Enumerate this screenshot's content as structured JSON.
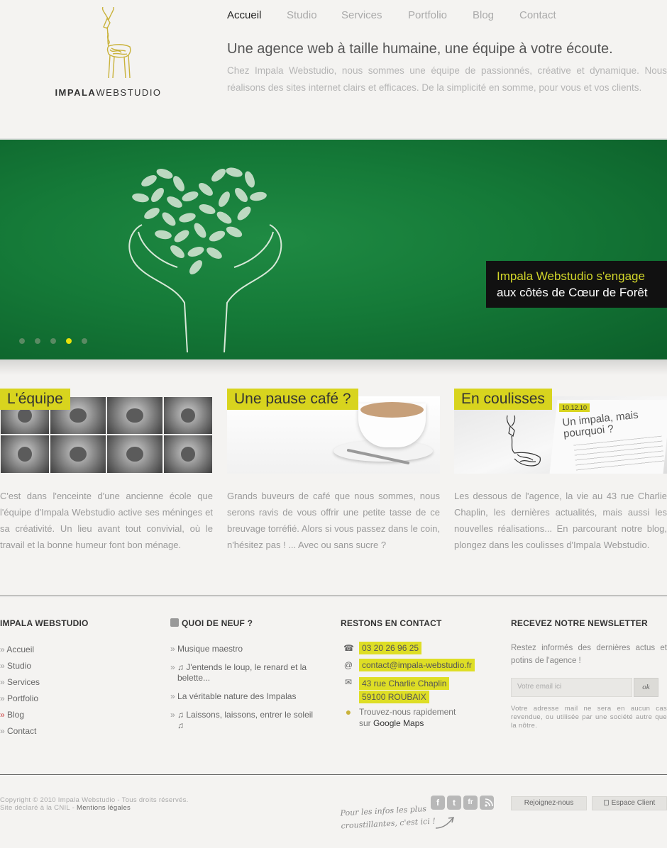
{
  "logo": {
    "name_bold": "IMPALA",
    "name_light": "WEBSTUDIO"
  },
  "nav": [
    {
      "label": "Accueil",
      "active": true
    },
    {
      "label": "Studio"
    },
    {
      "label": "Services"
    },
    {
      "label": "Portfolio"
    },
    {
      "label": "Blog"
    },
    {
      "label": "Contact"
    }
  ],
  "header": {
    "tagline": "Une agence web à taille humaine, une équipe à votre écoute.",
    "intro": "Chez Impala Webstudio, nous sommes une équipe de passionnés, créative et dynamique. Nous réalisons des sites internet clairs et efficaces. De la simplicité en somme, pour vous et vos clients."
  },
  "slider": {
    "caption_line1": "Impala Webstudio s'engage",
    "caption_line2": "aux côtés de Cœur de Forêt",
    "dots": 5,
    "active_dot": 4,
    "accent": "#d2d62a"
  },
  "features": [
    {
      "label": "L'équipe",
      "text": "C'est dans l'enceinte d'une ancienne école que l'équipe d'Impala Webstudio active ses méninges et sa créativité. Un lieu avant tout convivial, où le travail et la bonne humeur font bon ménage."
    },
    {
      "label": "Une pause café ?",
      "text": "Grands buveurs de café que nous sommes, nous serons ravis de vous offrir une petite tasse de ce breuvage torréfié. Alors si vous passez dans le coin, n'hésitez pas ! ... Avec ou sans sucre ?"
    },
    {
      "label": "En coulisses",
      "text": "Les dessous de l'agence, la vie au 43 rue Charlie Chaplin, les dernières actualités, mais aussi les nouvelles réalisations... En parcourant notre blog, plongez dans les coulisses d'Impala Webstudio.",
      "img_date": "10.12.10",
      "img_title": "Un impala, mais pourquoi ?"
    }
  ],
  "footer": {
    "col1": {
      "title": "IMPALA WEBSTUDIO",
      "links": [
        "Accueil",
        "Studio",
        "Services",
        "Portfolio",
        "Blog",
        "Contact"
      ]
    },
    "col2": {
      "title": "QUOI DE NEUF ?",
      "items": [
        "Musique maestro",
        "♫ J'entends le loup, le renard et la belette...",
        "La véritable nature des Impalas",
        "♫ Laissons, laissons, entrer le soleil ♫"
      ]
    },
    "col3": {
      "title": "RESTONS EN CONTACT",
      "phone": "03 20 26 96 25",
      "email": "contact@impala-webstudio.fr",
      "address1": "43 rue Charlie Chaplin",
      "address2": "59100 ROUBAIX",
      "maps_line1": "Trouvez-nous rapidement",
      "maps_line2_prefix": "sur ",
      "maps_link": "Google Maps"
    },
    "col4": {
      "title": "RECEVEZ NOTRE NEWSLETTER",
      "text": "Restez informés des dernières actus et potins de l'agence !",
      "placeholder": "Votre email ici",
      "button": "ok",
      "note": "Votre adresse mail ne sera en aucun cas revendue, ou utilisée par une société autre que la nôtre."
    }
  },
  "bottom": {
    "copyright": "Copyright © 2010 Impala Webstudio - Tous droits réservés.",
    "cnil": "Site déclaré à la CNIL - ",
    "legal": "Mentions légales",
    "social_line1": "Pour les infos les plus",
    "social_line2": "croustillantes, c'est ici !",
    "social_icons": [
      "f",
      "t",
      "fr",
      "rss"
    ],
    "join": "Rejoignez-nous",
    "client": "Espace Client"
  }
}
